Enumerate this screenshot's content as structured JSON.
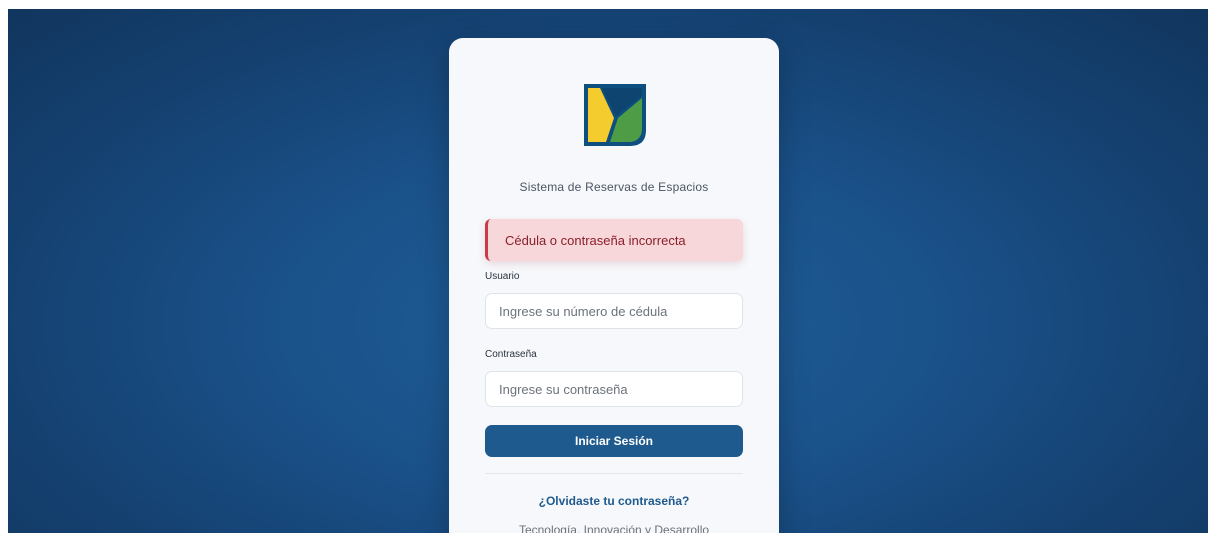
{
  "app": {
    "subtitle": "Sistema de Reservas de Espacios"
  },
  "alert": {
    "message": "Cédula o contraseña incorrecta"
  },
  "form": {
    "username_label": "Usuario",
    "username_placeholder": "Ingrese su número de cédula",
    "username_value": "",
    "password_label": "Contraseña",
    "password_placeholder": "Ingrese su contraseña",
    "password_value": "",
    "submit_label": "Iniciar Sesión"
  },
  "links": {
    "forgot_password": "¿Olvidaste tu contraseña?"
  },
  "footer": {
    "tagline": "Tecnología, Innovación y Desarrollo"
  },
  "icons": {
    "logo": "leaf-logo-icon"
  },
  "colors": {
    "background": "#1a5189",
    "primary": "#1f5a8e",
    "alert_bg": "#f8d7da",
    "alert_border": "#c63d49",
    "logo_navy": "#0e4f80",
    "logo_yellow": "#f5cc2d",
    "logo_green": "#4e9c45"
  }
}
